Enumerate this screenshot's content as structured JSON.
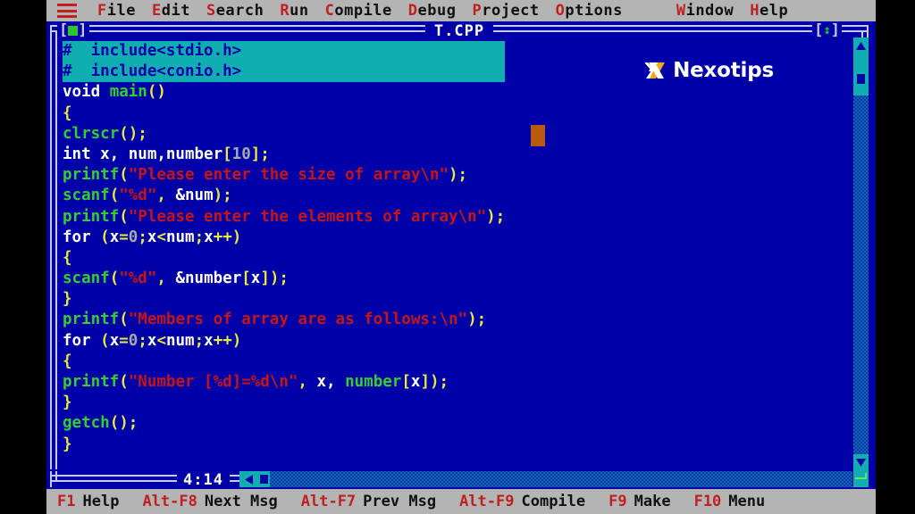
{
  "menu": {
    "hamburger_icon": "hamburger-icon",
    "items": [
      {
        "label": "File",
        "hotkey": "F",
        "rest": "ile"
      },
      {
        "label": "Edit",
        "hotkey": "E",
        "rest": "dit"
      },
      {
        "label": "Search",
        "hotkey": "S",
        "rest": "earch"
      },
      {
        "label": "Run",
        "hotkey": "R",
        "rest": "un"
      },
      {
        "label": "Compile",
        "hotkey": "C",
        "rest": "ompile"
      },
      {
        "label": "Debug",
        "hotkey": "D",
        "rest": "ebug"
      },
      {
        "label": "Project",
        "hotkey": "P",
        "rest": "roject"
      },
      {
        "label": "Options",
        "hotkey": "O",
        "rest": "ptions"
      },
      {
        "label": "Window",
        "hotkey": "W",
        "rest": "indow"
      },
      {
        "label": "Help",
        "hotkey": "H",
        "rest": "elp"
      }
    ]
  },
  "window": {
    "title": "T.CPP",
    "close_box": "[■]",
    "zoom_box": "[↕]",
    "position": "4:14"
  },
  "watermark": {
    "text": "Nexotips",
    "logo_icon": "nexotips-x-logo-icon",
    "colors": {
      "stroke_light": "#FFFFFF",
      "stroke_accent": "#F0A818"
    }
  },
  "code": {
    "lines": [
      {
        "selected": true,
        "tokens": [
          {
            "t": "pp",
            "v": "#  include<stdio.h>"
          }
        ]
      },
      {
        "selected": true,
        "tokens": [
          {
            "t": "pp",
            "v": "#  include<conio.h>"
          }
        ]
      },
      {
        "selected": false,
        "tokens": [
          {
            "t": "kw",
            "v": "void"
          },
          {
            "t": "id",
            "v": " "
          },
          {
            "t": "fn",
            "v": "main"
          },
          {
            "t": "pun",
            "v": "()"
          }
        ]
      },
      {
        "selected": false,
        "tokens": [
          {
            "t": "pun",
            "v": "{"
          }
        ]
      },
      {
        "selected": false,
        "tokens": [
          {
            "t": "fn",
            "v": "clrscr"
          },
          {
            "t": "pun",
            "v": "();"
          }
        ]
      },
      {
        "selected": false,
        "tokens": [
          {
            "t": "kw",
            "v": "int"
          },
          {
            "t": "id",
            "v": " x, num,number"
          },
          {
            "t": "pun",
            "v": "["
          },
          {
            "t": "num",
            "v": "10"
          },
          {
            "t": "pun",
            "v": "];"
          }
        ]
      },
      {
        "selected": false,
        "tokens": [
          {
            "t": "fn",
            "v": "printf"
          },
          {
            "t": "pun",
            "v": "("
          },
          {
            "t": "str",
            "v": "\"Please enter the size of array\\n\""
          },
          {
            "t": "pun",
            "v": ");"
          }
        ]
      },
      {
        "selected": false,
        "tokens": [
          {
            "t": "fn",
            "v": "scanf"
          },
          {
            "t": "pun",
            "v": "("
          },
          {
            "t": "str",
            "v": "\"%d\""
          },
          {
            "t": "pun",
            "v": ","
          },
          {
            "t": "id",
            "v": " &num"
          },
          {
            "t": "pun",
            "v": ");"
          }
        ]
      },
      {
        "selected": false,
        "tokens": [
          {
            "t": "fn",
            "v": "printf"
          },
          {
            "t": "pun",
            "v": "("
          },
          {
            "t": "str",
            "v": "\"Please enter the elements of array\\n\""
          },
          {
            "t": "pun",
            "v": ");"
          }
        ]
      },
      {
        "selected": false,
        "tokens": [
          {
            "t": "kw",
            "v": "for"
          },
          {
            "t": "id",
            "v": " "
          },
          {
            "t": "pun",
            "v": "("
          },
          {
            "t": "id",
            "v": "x"
          },
          {
            "t": "pun",
            "v": "="
          },
          {
            "t": "num",
            "v": "0"
          },
          {
            "t": "pun",
            "v": ";"
          },
          {
            "t": "id",
            "v": "x"
          },
          {
            "t": "pun",
            "v": "<"
          },
          {
            "t": "id",
            "v": "num"
          },
          {
            "t": "pun",
            "v": ";"
          },
          {
            "t": "id",
            "v": "x"
          },
          {
            "t": "pun",
            "v": "++)"
          }
        ]
      },
      {
        "selected": false,
        "tokens": [
          {
            "t": "pun",
            "v": "{"
          }
        ]
      },
      {
        "selected": false,
        "tokens": [
          {
            "t": "fn",
            "v": "scanf"
          },
          {
            "t": "pun",
            "v": "("
          },
          {
            "t": "str",
            "v": "\"%d\""
          },
          {
            "t": "pun",
            "v": ","
          },
          {
            "t": "id",
            "v": " &number"
          },
          {
            "t": "pun",
            "v": "["
          },
          {
            "t": "id",
            "v": "x"
          },
          {
            "t": "pun",
            "v": "]);"
          }
        ]
      },
      {
        "selected": false,
        "tokens": [
          {
            "t": "pun",
            "v": "}"
          }
        ]
      },
      {
        "selected": false,
        "tokens": [
          {
            "t": "fn",
            "v": "printf"
          },
          {
            "t": "pun",
            "v": "("
          },
          {
            "t": "str",
            "v": "\"Members of array are as follows:\\n\""
          },
          {
            "t": "pun",
            "v": ");"
          }
        ]
      },
      {
        "selected": false,
        "tokens": [
          {
            "t": "kw",
            "v": "for"
          },
          {
            "t": "id",
            "v": " "
          },
          {
            "t": "pun",
            "v": "("
          },
          {
            "t": "id",
            "v": "x"
          },
          {
            "t": "pun",
            "v": "="
          },
          {
            "t": "num",
            "v": "0"
          },
          {
            "t": "pun",
            "v": ";"
          },
          {
            "t": "id",
            "v": "x"
          },
          {
            "t": "pun",
            "v": "<"
          },
          {
            "t": "id",
            "v": "num"
          },
          {
            "t": "pun",
            "v": ";"
          },
          {
            "t": "id",
            "v": "x"
          },
          {
            "t": "pun",
            "v": "++)"
          }
        ]
      },
      {
        "selected": false,
        "tokens": [
          {
            "t": "pun",
            "v": "{"
          }
        ]
      },
      {
        "selected": false,
        "tokens": [
          {
            "t": "fn",
            "v": "printf"
          },
          {
            "t": "pun",
            "v": "("
          },
          {
            "t": "str",
            "v": "\"Number [%d]=%d\\n\""
          },
          {
            "t": "pun",
            "v": ","
          },
          {
            "t": "id",
            "v": " x,"
          },
          {
            "t": "fn",
            "v": " number"
          },
          {
            "t": "pun",
            "v": "["
          },
          {
            "t": "id",
            "v": "x"
          },
          {
            "t": "pun",
            "v": "]);"
          }
        ]
      },
      {
        "selected": false,
        "tokens": [
          {
            "t": "pun",
            "v": "}"
          }
        ]
      },
      {
        "selected": false,
        "tokens": [
          {
            "t": "fn",
            "v": "getch"
          },
          {
            "t": "pun",
            "v": "();"
          }
        ]
      },
      {
        "selected": false,
        "tokens": [
          {
            "t": "pun",
            "v": "}"
          }
        ]
      }
    ]
  },
  "scrollbars": {
    "v_up_glyph": "▲",
    "v_down_glyph": "▼",
    "h_left_glyph": "◀"
  },
  "statusbar": {
    "items": [
      {
        "key": "F1",
        "label": "Help"
      },
      {
        "key": "Alt-F8",
        "label": "Next Msg"
      },
      {
        "key": "Alt-F7",
        "label": "Prev Msg"
      },
      {
        "key": "Alt-F9",
        "label": "Compile"
      },
      {
        "key": "F9",
        "label": "Make"
      },
      {
        "key": "F10",
        "label": "Menu"
      }
    ]
  }
}
